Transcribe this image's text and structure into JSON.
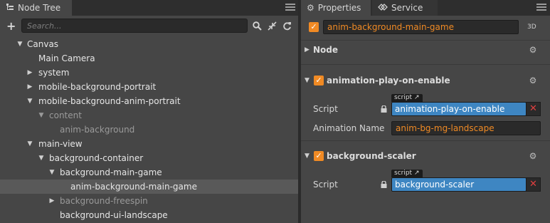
{
  "node_tree": {
    "tab_label": "Node Tree",
    "search_placeholder": "Search...",
    "items": [
      {
        "label": "Canvas",
        "arrow": "▼",
        "style": "white"
      },
      {
        "label": "Main Camera",
        "arrow": "",
        "style": "white"
      },
      {
        "label": "system",
        "arrow": "▶",
        "style": "white"
      },
      {
        "label": "mobile-background-portrait",
        "arrow": "▶",
        "style": "white"
      },
      {
        "label": "mobile-background-anim-portrait",
        "arrow": "▼",
        "style": "white"
      },
      {
        "label": "content",
        "arrow": "▼",
        "style": "dim"
      },
      {
        "label": "anim-background",
        "arrow": "",
        "style": "dim"
      },
      {
        "label": "main-view",
        "arrow": "▼",
        "style": "white"
      },
      {
        "label": "background-container",
        "arrow": "▼",
        "style": "white"
      },
      {
        "label": "background-main-game",
        "arrow": "▼",
        "style": "white"
      },
      {
        "label": "anim-background-main-game",
        "arrow": "",
        "style": "white",
        "selected": true
      },
      {
        "label": "background-freespin",
        "arrow": "▶",
        "style": "dim"
      },
      {
        "label": "background-ui-landscape",
        "arrow": "",
        "style": "white"
      }
    ]
  },
  "properties": {
    "tab_label": "Properties",
    "service_tab_label": "Service",
    "node_name": "anim-background-main-game",
    "mode_label": "3D",
    "node_section": "Node",
    "components": [
      {
        "title": "animation-play-on-enable",
        "script_tag": "script",
        "script_label": "Script",
        "script_value": "animation-play-on-enable",
        "extra_label": "Animation Name",
        "extra_value": "anim-bg-mg-landscape"
      },
      {
        "title": "background-scaler",
        "script_tag": "script",
        "script_label": "Script",
        "script_value": "background-scaler"
      }
    ]
  },
  "colors": {
    "accent_orange": "#f08a24",
    "selected_blue": "#3e86c2",
    "remove_red": "#e04040"
  }
}
